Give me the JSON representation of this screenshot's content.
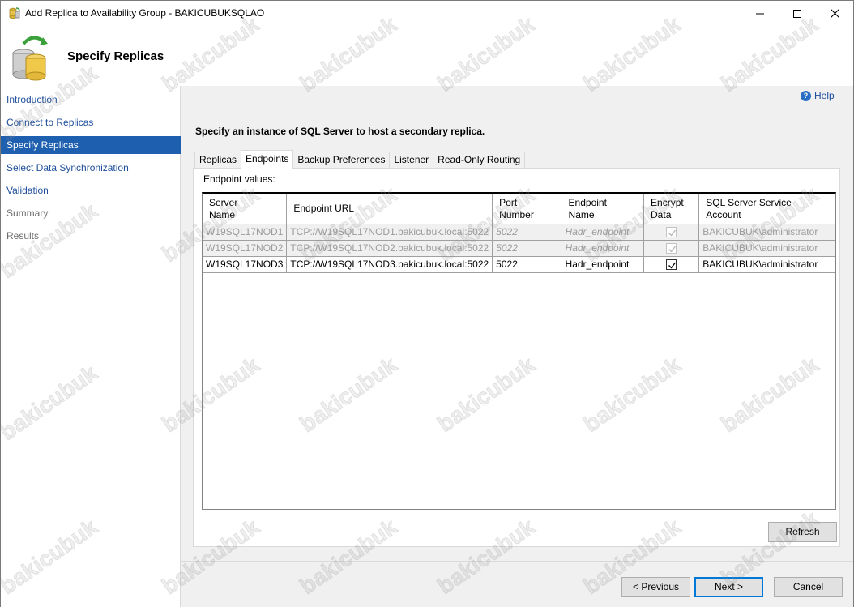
{
  "window": {
    "title": "Add Replica to Availability Group - BAKICUBUKSQLAO"
  },
  "header": {
    "page_title": "Specify Replicas"
  },
  "nav": {
    "items": [
      {
        "label": "Introduction",
        "state": "link"
      },
      {
        "label": "Connect to Replicas",
        "state": "link"
      },
      {
        "label": "Specify Replicas",
        "state": "active"
      },
      {
        "label": "Select Data Synchronization",
        "state": "link"
      },
      {
        "label": "Validation",
        "state": "link"
      },
      {
        "label": "Summary",
        "state": "disabled"
      },
      {
        "label": "Results",
        "state": "disabled"
      }
    ]
  },
  "content": {
    "help_label": "Help",
    "instruction": "Specify an instance of SQL Server to host a secondary replica.",
    "tabs": [
      {
        "label": "Replicas",
        "active": false
      },
      {
        "label": "Endpoints",
        "active": true
      },
      {
        "label": "Backup Preferences",
        "active": false
      },
      {
        "label": "Listener",
        "active": false
      },
      {
        "label": "Read-Only Routing",
        "active": false
      }
    ],
    "panel_label": "Endpoint values:",
    "table": {
      "headers": [
        [
          "Server",
          "Name"
        ],
        [
          "Endpoint URL",
          ""
        ],
        [
          "Port",
          "Number"
        ],
        [
          "Endpoint",
          "Name"
        ],
        [
          "Encrypt",
          "Data"
        ],
        [
          "SQL Server Service",
          "Account"
        ]
      ],
      "rows": [
        {
          "server": "W19SQL17NOD1",
          "url": "TCP://W19SQL17NOD1.bakicubuk.local:5022",
          "port": "5022",
          "endpoint": "Hadr_endpoint",
          "encrypt": true,
          "account": "BAKICUBUK\\administrator",
          "enabled": false
        },
        {
          "server": "W19SQL17NOD2",
          "url": "TCP://W19SQL17NOD2.bakicubuk.local:5022",
          "port": "5022",
          "endpoint": "Hadr_endpoint",
          "encrypt": true,
          "account": "BAKICUBUK\\administrator",
          "enabled": false
        },
        {
          "server": "W19SQL17NOD3",
          "url": "TCP://W19SQL17NOD3.bakicubuk.local:5022",
          "port": "5022",
          "endpoint": "Hadr_endpoint",
          "encrypt": true,
          "account": "BAKICUBUK\\administrator",
          "enabled": true
        }
      ]
    },
    "refresh_label": "Refresh"
  },
  "footer": {
    "previous_label": "< Previous",
    "next_label": "Next >",
    "cancel_label": "Cancel"
  },
  "watermark": "bakicubuk",
  "colors": {
    "accent": "#1f5fb0",
    "link": "#1e4e9c",
    "panel_bg": "#f0f0f0"
  }
}
